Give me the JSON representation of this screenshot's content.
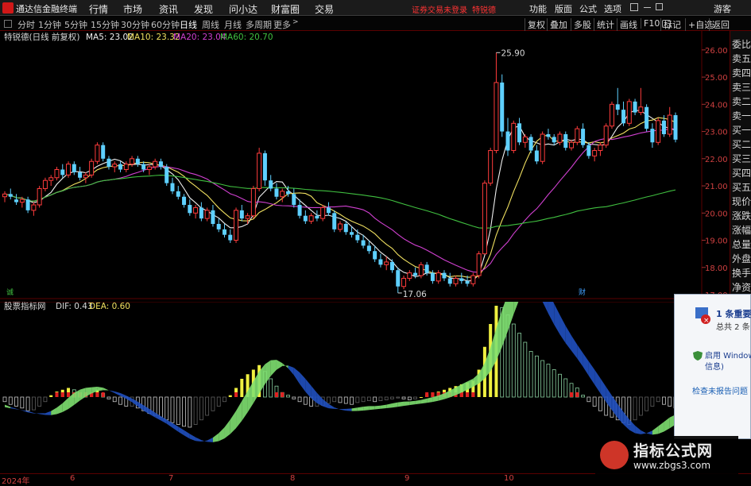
{
  "topbar": {
    "app_title": "通达信金融终端",
    "menus": [
      "行情",
      "市场",
      "资讯",
      "发现",
      "问小达",
      "财富圈",
      "交易"
    ],
    "warning": "证券交易未登录",
    "stock_name": "特锐德",
    "right_menus": [
      "功能",
      "版面",
      "公式",
      "选项"
    ],
    "guest": "游客"
  },
  "periodbar": {
    "periods": [
      "分时",
      "1分钟",
      "5分钟",
      "15分钟",
      "30分钟",
      "60分钟",
      "日线",
      "周线",
      "月线",
      "多周期",
      "更多"
    ],
    "active_period": "日线",
    "tools": [
      "复权",
      "叠加",
      "多股",
      "统计",
      "画线",
      "F10",
      "标记",
      "+自选",
      "返回"
    ]
  },
  "main_chart": {
    "legend_stock": "特锐德(日线 前复权)",
    "ma": [
      {
        "label": "MA5: 23.02",
        "color": "#f0f0f0"
      },
      {
        "label": "MA10: 23.32",
        "color": "#f0e060"
      },
      {
        "label": "MA20: 23.04",
        "color": "#d040d0"
      },
      {
        "label": "MA60: 20.70",
        "color": "#40c040"
      }
    ],
    "high_label": "25.90",
    "low_label": "17.06",
    "marker_a": "诚",
    "marker_b": "财",
    "price_ticks": [
      "26.00",
      "25.00",
      "24.00",
      "23.00",
      "22.00",
      "21.00",
      "20.00",
      "19.00",
      "18.00",
      "17.00"
    ]
  },
  "macd": {
    "legend_name": "股票指标网",
    "dif": "DIF: 0.43",
    "dea": "DEA: 0.60"
  },
  "right_panel": [
    "委比",
    "卖五",
    "卖四",
    "卖三",
    "卖二",
    "卖一",
    "买一",
    "买二",
    "买三",
    "买四",
    "买五",
    "现价",
    "涨跌",
    "涨幅",
    "总量",
    "外盘",
    "换手",
    "净资"
  ],
  "date_axis": [
    "2024年",
    "6",
    "7",
    "8",
    "9",
    "10"
  ],
  "notification": {
    "title": "1 条重要消",
    "subtitle": "总共 2 条",
    "line1": "启用 Windows",
    "line2": "信息)",
    "link": "检查未报告问题"
  },
  "watermark": {
    "title": "指标公式网",
    "url": "www.zbgs3.com"
  },
  "chart_data": {
    "type": "candlestick",
    "ylim": [
      17.0,
      26.2
    ],
    "candles": [
      [
        20.6,
        20.8,
        20.4,
        20.7
      ],
      [
        20.7,
        20.9,
        20.5,
        20.6
      ],
      [
        20.5,
        20.7,
        20.3,
        20.4
      ],
      [
        20.4,
        20.6,
        20.2,
        20.5
      ],
      [
        20.5,
        20.6,
        20.0,
        20.1
      ],
      [
        20.1,
        20.4,
        19.9,
        20.3
      ],
      [
        20.3,
        21.0,
        20.2,
        20.9
      ],
      [
        20.9,
        21.3,
        20.8,
        21.2
      ],
      [
        21.2,
        21.4,
        21.0,
        21.3
      ],
      [
        21.3,
        21.7,
        21.2,
        21.6
      ],
      [
        21.6,
        21.8,
        21.3,
        21.4
      ],
      [
        21.4,
        21.9,
        21.3,
        21.8
      ],
      [
        21.8,
        21.9,
        21.4,
        21.5
      ],
      [
        21.5,
        21.7,
        21.2,
        21.3
      ],
      [
        21.3,
        21.5,
        21.1,
        21.4
      ],
      [
        21.4,
        22.0,
        21.3,
        21.9
      ],
      [
        21.9,
        22.6,
        21.8,
        22.5
      ],
      [
        22.5,
        22.6,
        21.9,
        22.0
      ],
      [
        22.0,
        22.1,
        21.6,
        21.7
      ],
      [
        21.7,
        21.9,
        21.5,
        21.8
      ],
      [
        21.8,
        21.9,
        21.5,
        21.6
      ],
      [
        21.6,
        21.9,
        21.5,
        21.8
      ],
      [
        21.8,
        22.1,
        21.7,
        22.0
      ],
      [
        22.0,
        22.1,
        21.7,
        21.8
      ],
      [
        21.8,
        21.9,
        21.5,
        21.6
      ],
      [
        21.6,
        21.8,
        21.4,
        21.7
      ],
      [
        21.7,
        22.0,
        21.6,
        21.9
      ],
      [
        21.9,
        22.0,
        21.6,
        21.7
      ],
      [
        21.7,
        21.8,
        21.0,
        21.1
      ],
      [
        21.1,
        21.3,
        20.7,
        20.8
      ],
      [
        20.8,
        21.0,
        20.5,
        20.6
      ],
      [
        20.6,
        20.7,
        20.2,
        20.3
      ],
      [
        20.3,
        20.5,
        19.9,
        20.0
      ],
      [
        20.0,
        20.3,
        19.8,
        20.2
      ],
      [
        20.2,
        20.4,
        19.7,
        19.8
      ],
      [
        19.8,
        20.2,
        19.7,
        20.1
      ],
      [
        20.1,
        20.3,
        19.5,
        19.6
      ],
      [
        19.6,
        19.8,
        19.3,
        19.4
      ],
      [
        19.4,
        19.6,
        19.1,
        19.2
      ],
      [
        19.2,
        19.4,
        18.9,
        19.0
      ],
      [
        19.0,
        20.2,
        18.9,
        20.1
      ],
      [
        20.1,
        20.3,
        19.7,
        19.8
      ],
      [
        19.8,
        20.0,
        19.6,
        19.9
      ],
      [
        19.9,
        21.0,
        19.8,
        20.9
      ],
      [
        20.9,
        22.4,
        20.8,
        22.2
      ],
      [
        22.2,
        22.3,
        21.0,
        21.2
      ],
      [
        21.2,
        21.4,
        20.8,
        20.9
      ],
      [
        20.9,
        21.1,
        20.5,
        20.6
      ],
      [
        20.6,
        20.9,
        20.4,
        20.8
      ],
      [
        20.8,
        21.0,
        20.6,
        20.7
      ],
      [
        20.7,
        20.9,
        20.2,
        20.3
      ],
      [
        20.3,
        20.5,
        19.8,
        19.9
      ],
      [
        19.9,
        20.1,
        19.6,
        19.7
      ],
      [
        19.7,
        20.0,
        19.6,
        19.9
      ],
      [
        19.9,
        20.1,
        19.7,
        19.8
      ],
      [
        19.8,
        20.3,
        19.7,
        20.2
      ],
      [
        20.2,
        20.4,
        19.9,
        20.0
      ],
      [
        20.0,
        20.1,
        19.3,
        19.4
      ],
      [
        19.4,
        19.7,
        19.3,
        19.6
      ],
      [
        19.6,
        19.7,
        19.2,
        19.3
      ],
      [
        19.3,
        19.5,
        19.1,
        19.2
      ],
      [
        19.2,
        19.4,
        18.9,
        19.0
      ],
      [
        19.0,
        19.2,
        18.7,
        18.8
      ],
      [
        18.8,
        19.0,
        18.5,
        18.6
      ],
      [
        18.6,
        18.8,
        18.2,
        18.3
      ],
      [
        18.3,
        18.5,
        18.0,
        18.1
      ],
      [
        18.1,
        18.4,
        17.9,
        18.2
      ],
      [
        18.2,
        18.3,
        17.8,
        17.9
      ],
      [
        17.9,
        18.0,
        17.06,
        17.3
      ],
      [
        17.3,
        17.7,
        17.2,
        17.6
      ],
      [
        17.6,
        17.9,
        17.5,
        17.8
      ],
      [
        17.8,
        18.0,
        17.6,
        17.7
      ],
      [
        17.7,
        18.2,
        17.6,
        18.1
      ],
      [
        18.1,
        18.2,
        17.7,
        17.8
      ],
      [
        17.8,
        17.9,
        17.4,
        17.5
      ],
      [
        17.5,
        17.9,
        17.4,
        17.8
      ],
      [
        17.8,
        17.9,
        17.5,
        17.6
      ],
      [
        17.6,
        17.8,
        17.3,
        17.4
      ],
      [
        17.4,
        17.7,
        17.3,
        17.6
      ],
      [
        17.6,
        17.8,
        17.4,
        17.5
      ],
      [
        17.5,
        17.7,
        17.3,
        17.4
      ],
      [
        17.4,
        17.8,
        17.3,
        17.7
      ],
      [
        17.7,
        18.6,
        17.6,
        18.5
      ],
      [
        18.5,
        21.2,
        18.5,
        21.1
      ],
      [
        21.1,
        22.4,
        21.0,
        22.3
      ],
      [
        22.3,
        25.9,
        22.2,
        24.8
      ],
      [
        24.8,
        25.1,
        22.8,
        23.0
      ],
      [
        23.0,
        23.5,
        22.1,
        22.3
      ],
      [
        22.3,
        23.4,
        22.2,
        23.3
      ],
      [
        23.3,
        23.5,
        22.5,
        22.6
      ],
      [
        22.6,
        22.9,
        22.4,
        22.8
      ],
      [
        22.8,
        22.9,
        22.2,
        22.3
      ],
      [
        22.3,
        22.5,
        21.8,
        21.9
      ],
      [
        21.9,
        23.0,
        21.8,
        22.9
      ],
      [
        22.9,
        23.1,
        22.7,
        22.8
      ],
      [
        22.8,
        22.9,
        22.5,
        22.6
      ],
      [
        22.6,
        23.0,
        22.5,
        22.9
      ],
      [
        22.9,
        23.0,
        22.3,
        22.4
      ],
      [
        22.4,
        22.7,
        22.3,
        22.6
      ],
      [
        22.6,
        23.2,
        22.5,
        23.1
      ],
      [
        23.1,
        23.3,
        22.4,
        22.5
      ],
      [
        22.5,
        22.6,
        22.0,
        22.1
      ],
      [
        22.1,
        22.4,
        21.9,
        22.3
      ],
      [
        22.3,
        22.6,
        22.1,
        22.5
      ],
      [
        22.5,
        23.3,
        22.4,
        23.2
      ],
      [
        23.2,
        24.1,
        23.1,
        24.0
      ],
      [
        24.0,
        24.6,
        23.6,
        23.8
      ],
      [
        23.8,
        24.1,
        23.2,
        23.3
      ],
      [
        23.3,
        24.2,
        23.2,
        24.1
      ],
      [
        24.1,
        24.2,
        23.6,
        23.7
      ],
      [
        23.7,
        24.6,
        23.6,
        23.9
      ],
      [
        23.9,
        24.0,
        23.0,
        23.1
      ],
      [
        23.1,
        23.3,
        22.4,
        22.6
      ],
      [
        22.6,
        23.5,
        22.5,
        23.4
      ],
      [
        23.4,
        23.6,
        22.8,
        22.9
      ],
      [
        22.9,
        23.9,
        22.8,
        23.6
      ],
      [
        23.6,
        23.7,
        22.6,
        22.7
      ]
    ],
    "macd_hist": [
      -0.05,
      -0.08,
      -0.1,
      -0.12,
      -0.15,
      -0.14,
      -0.1,
      -0.05,
      0.02,
      0.06,
      0.08,
      0.1,
      0.08,
      0.05,
      0.03,
      0.05,
      0.08,
      0.04,
      -0.02,
      -0.05,
      -0.08,
      -0.1,
      -0.1,
      -0.12,
      -0.15,
      -0.18,
      -0.2,
      -0.22,
      -0.25,
      -0.28,
      -0.3,
      -0.32,
      -0.33,
      -0.3,
      -0.25,
      -0.2,
      -0.15,
      -0.1,
      -0.05,
      0.02,
      0.1,
      0.2,
      0.25,
      0.3,
      0.35,
      0.28,
      0.2,
      0.12,
      0.05,
      0.02,
      -0.02,
      -0.05,
      -0.08,
      -0.1,
      -0.1,
      -0.09,
      -0.07,
      -0.05,
      -0.06,
      -0.07,
      -0.08,
      -0.06,
      -0.05,
      -0.04,
      -0.05,
      -0.04,
      -0.03,
      -0.02,
      -0.01,
      -0.02,
      -0.03,
      -0.02,
      0.0,
      0.03,
      0.05,
      0.06,
      0.08,
      0.1,
      0.12,
      0.14,
      0.16,
      0.18,
      0.3,
      0.55,
      0.8,
      1.0,
      0.98,
      0.9,
      0.8,
      0.7,
      0.6,
      0.5,
      0.45,
      0.4,
      0.36,
      0.3,
      0.25,
      0.2,
      0.15,
      0.1,
      0.02,
      -0.05,
      -0.1,
      -0.15,
      -0.2,
      -0.22,
      -0.25,
      -0.28,
      -0.3,
      -0.25,
      -0.2,
      -0.15,
      -0.1,
      -0.05,
      -0.08,
      -0.1,
      -0.12
    ]
  }
}
